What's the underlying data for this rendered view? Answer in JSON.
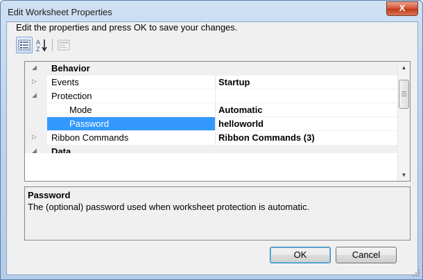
{
  "window": {
    "title": "Edit Worksheet Properties",
    "close_glyph": "X"
  },
  "instructions": "Edit the properties and press OK to save your changes.",
  "toolbar": {
    "categorized_icon": "categorized-view-icon",
    "alphabetical_icon": "alphabetical-sort-icon",
    "property_pages_icon": "property-pages-icon"
  },
  "grid": {
    "rows": [
      {
        "type": "category",
        "expander": "◢",
        "name": "Behavior",
        "value": ""
      },
      {
        "type": "property",
        "expander": "▷",
        "name": "Events",
        "value": "Startup"
      },
      {
        "type": "property",
        "expander": "◢",
        "name": "Protection",
        "value": ""
      },
      {
        "type": "child",
        "expander": "",
        "name": "Mode",
        "value": "Automatic"
      },
      {
        "type": "child",
        "expander": "",
        "name": "Password",
        "value": "helloworld",
        "selected": true
      },
      {
        "type": "property",
        "expander": "▷",
        "name": "Ribbon Commands",
        "value": "Ribbon Commands (3)"
      },
      {
        "type": "category",
        "expander": "◢",
        "name": "Data",
        "value": ""
      }
    ]
  },
  "description": {
    "title": "Password",
    "text": "The (optional) password used when worksheet protection is automatic."
  },
  "buttons": {
    "ok": "OK",
    "cancel": "Cancel"
  },
  "colors": {
    "selection": "#3399ff",
    "title_bar": "#bfd5ee",
    "close_button": "#c1391c"
  }
}
